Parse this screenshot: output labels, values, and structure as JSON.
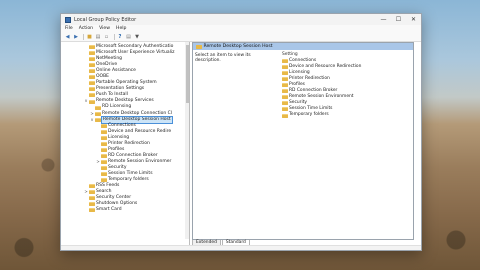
{
  "window": {
    "title": "Local Group Policy Editor",
    "controls": [
      "—",
      "☐",
      "✕"
    ]
  },
  "menu": [
    "File",
    "Action",
    "View",
    "Help"
  ],
  "toolbar": [
    "back-icon",
    "forward-icon",
    "up-folder-icon",
    "show-tree-icon",
    "export-icon",
    "help-icon",
    "properties-icon",
    "filter-icon"
  ],
  "tree": [
    {
      "label": "Microsoft Secondary Authenticatio",
      "level": 0,
      "expander": ""
    },
    {
      "label": "Microsoft User Experience Virtualiz",
      "level": 0,
      "expander": ""
    },
    {
      "label": "NetMeeting",
      "level": 0,
      "expander": ""
    },
    {
      "label": "OneDrive",
      "level": 0,
      "expander": ""
    },
    {
      "label": "Online Assistance",
      "level": 0,
      "expander": ""
    },
    {
      "label": "OOBE",
      "level": 0,
      "expander": ""
    },
    {
      "label": "Portable Operating System",
      "level": 0,
      "expander": ""
    },
    {
      "label": "Presentation Settings",
      "level": 0,
      "expander": ""
    },
    {
      "label": "Push To Install",
      "level": 0,
      "expander": ""
    },
    {
      "label": "Remote Desktop Services",
      "level": 0,
      "expander": "v"
    },
    {
      "label": "RD Licensing",
      "level": 1,
      "expander": ""
    },
    {
      "label": "Remote Desktop Connection Cl",
      "level": 1,
      "expander": ">"
    },
    {
      "label": "Remote Desktop Session Host",
      "level": 1,
      "expander": "v",
      "selected": true
    },
    {
      "label": "Connections",
      "level": 2,
      "expander": ""
    },
    {
      "label": "Device and Resource Redire",
      "level": 2,
      "expander": ""
    },
    {
      "label": "Licensing",
      "level": 2,
      "expander": ""
    },
    {
      "label": "Printer Redirection",
      "level": 2,
      "expander": ""
    },
    {
      "label": "Profiles",
      "level": 2,
      "expander": ""
    },
    {
      "label": "RD Connection Broker",
      "level": 2,
      "expander": ""
    },
    {
      "label": "Remote Session Environmer",
      "level": 2,
      "expander": ">"
    },
    {
      "label": "Security",
      "level": 2,
      "expander": ""
    },
    {
      "label": "Session Time Limits",
      "level": 2,
      "expander": ""
    },
    {
      "label": "Temporary folders",
      "level": 2,
      "expander": ""
    },
    {
      "label": "RSS Feeds",
      "level": 0,
      "expander": ""
    },
    {
      "label": "Search",
      "level": 0,
      "expander": ">"
    },
    {
      "label": "Security Center",
      "level": 0,
      "expander": ""
    },
    {
      "label": "Shutdown Options",
      "level": 0,
      "expander": ""
    },
    {
      "label": "Smart Card",
      "level": 0,
      "expander": ""
    }
  ],
  "right": {
    "header": "Remote Desktop Session Host",
    "description": "Select an item to view its description.",
    "column": "Setting",
    "items": [
      "Connections",
      "Device and Resource Redirection",
      "Licensing",
      "Printer Redirection",
      "Profiles",
      "RD Connection Broker",
      "Remote Session Environment",
      "Security",
      "Session Time Limits",
      "Temporary folders"
    ]
  },
  "tabs": [
    {
      "label": "Extended",
      "active": false
    },
    {
      "label": "Standard",
      "active": true
    }
  ]
}
